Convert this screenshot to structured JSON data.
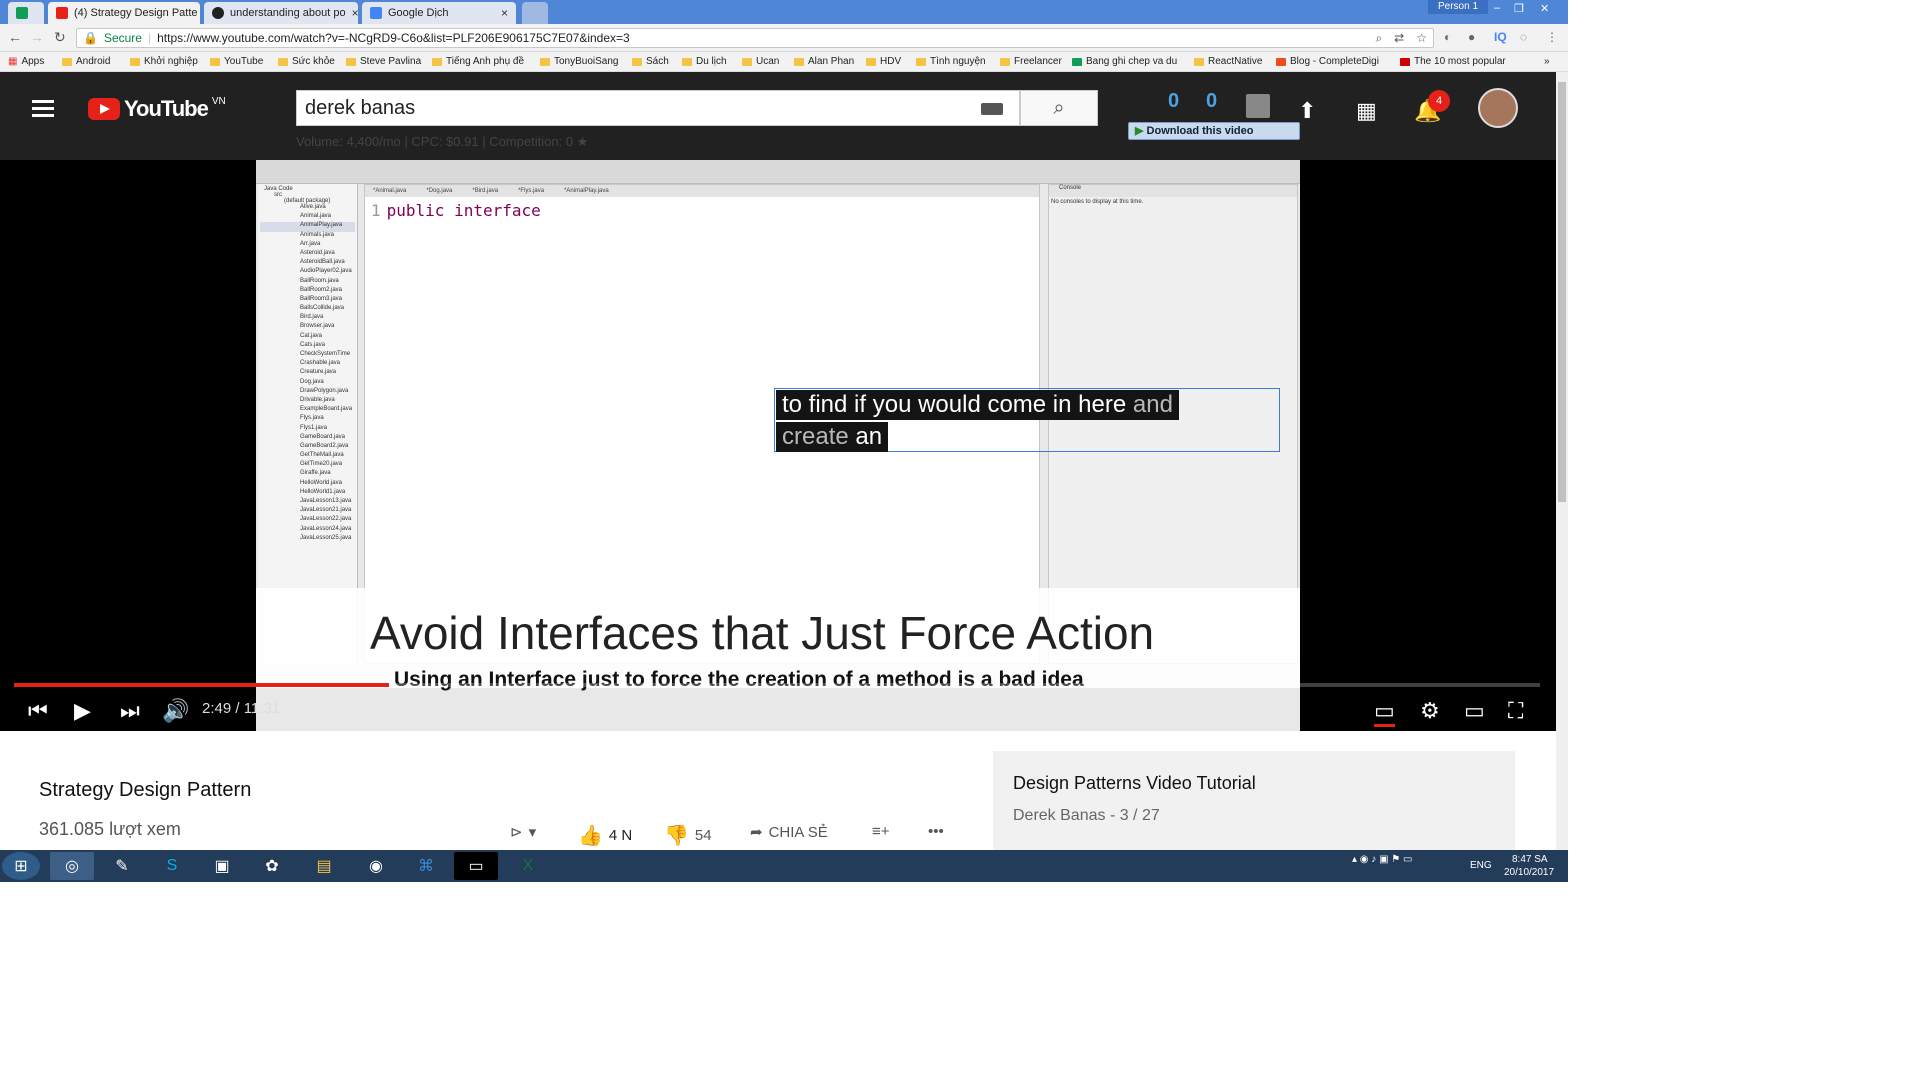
{
  "browser": {
    "tabs": [
      {
        "label": "(4) Strategy Design Patte",
        "icon": "youtube-icon",
        "active": true
      },
      {
        "label": "understanding about po",
        "icon": "github-icon",
        "active": false
      },
      {
        "label": "Google Dịch",
        "icon": "google-translate-icon",
        "active": false
      }
    ],
    "profile": "Person 1",
    "secure_label": "Secure",
    "url": "https://www.youtube.com/watch?v=-NCgRD9-C6o&list=PLF206E906175C7E07&index=3"
  },
  "bookmarks": [
    {
      "label": "Apps"
    },
    {
      "label": "Android"
    },
    {
      "label": "Khởi nghiệp"
    },
    {
      "label": "YouTube"
    },
    {
      "label": "Sức khỏe"
    },
    {
      "label": "Steve Pavlina"
    },
    {
      "label": "Tiếng Anh phụ đề"
    },
    {
      "label": "TonyBuoiSang"
    },
    {
      "label": "Sách"
    },
    {
      "label": "Du lịch"
    },
    {
      "label": "Ucan"
    },
    {
      "label": "Alan Phan"
    },
    {
      "label": "HDV"
    },
    {
      "label": "Tình nguyện"
    },
    {
      "label": "Freelancer"
    },
    {
      "label": "Bang ghi chep va du"
    },
    {
      "label": "ReactNative"
    },
    {
      "label": "Blog - CompleteDigi"
    },
    {
      "label": "The 10 most popular"
    }
  ],
  "youtube": {
    "logo_text": "YouTube",
    "region": "VN",
    "search_value": "derek banas",
    "seo_info": "Volume: 4,400/mo | CPC: $0.91 | Competition: 0",
    "stats": [
      "0",
      "0"
    ],
    "notification_count": "4",
    "download_label": "Download this video"
  },
  "video": {
    "code_line_number": "1",
    "code_text": "public interface",
    "caption_line1_main": "to find if you would come in here",
    "caption_line1_dim": "and",
    "caption_line2_dim": "create",
    "caption_line2_main": "an",
    "banner_title": "Avoid Interfaces that Just Force Action",
    "banner_subtitle": "Using an Interface just to force the creation of a method is a bad idea",
    "time_display": "2:49 / 11:31",
    "progress_fraction": 0.246,
    "accent": "#e62117"
  },
  "eclipse": {
    "tabs": [
      "*Animal.java",
      "*Dog.java",
      "*Bird.java",
      "*Flys.java",
      "*AnimalPlay.java"
    ],
    "console_title": "Console",
    "console_message": "No consoles to display at this time.",
    "project": "Java Code",
    "src": "src",
    "package": "(default package)",
    "files": [
      "Alive.java",
      "Animal.java",
      "AnimalPlay.java",
      "Animals.java",
      "Arr.java",
      "Asteroid.java",
      "AsteroidBall.java",
      "AudioPlayer02.java",
      "BallRoom.java",
      "BallRoom2.java",
      "BallRoom3.java",
      "BallsCollide.java",
      "Bird.java",
      "Browser.java",
      "Cat.java",
      "Cats.java",
      "CheckSystemTime",
      "Crashable.java",
      "Creature.java",
      "Dog.java",
      "DrawPolygon.java",
      "Drivable.java",
      "ExampleBoard.java",
      "Flys.java",
      "Flys1.java",
      "GameBoard.java",
      "GameBoard2.java",
      "GetTheMail.java",
      "GetTime20.java",
      "Giraffe.java",
      "HelloWorld.java",
      "HelloWorld1.java",
      "JavaLesson13.java",
      "JavaLesson21.java",
      "JavaLesson22.java",
      "JavaLesson24.java",
      "JavaLesson25.java"
    ]
  },
  "below": {
    "title": "Strategy Design Pattern",
    "views": "361.085 lượt xem",
    "likes": "4 N",
    "dislikes": "54",
    "share": "CHIA SẺ",
    "playlist_title": "Design Patterns Video Tutorial",
    "playlist_sub": "Derek Banas - 3 / 27"
  },
  "taskbar": {
    "language": "ENG",
    "time": "8:47 SA",
    "date": "20/10/2017"
  }
}
